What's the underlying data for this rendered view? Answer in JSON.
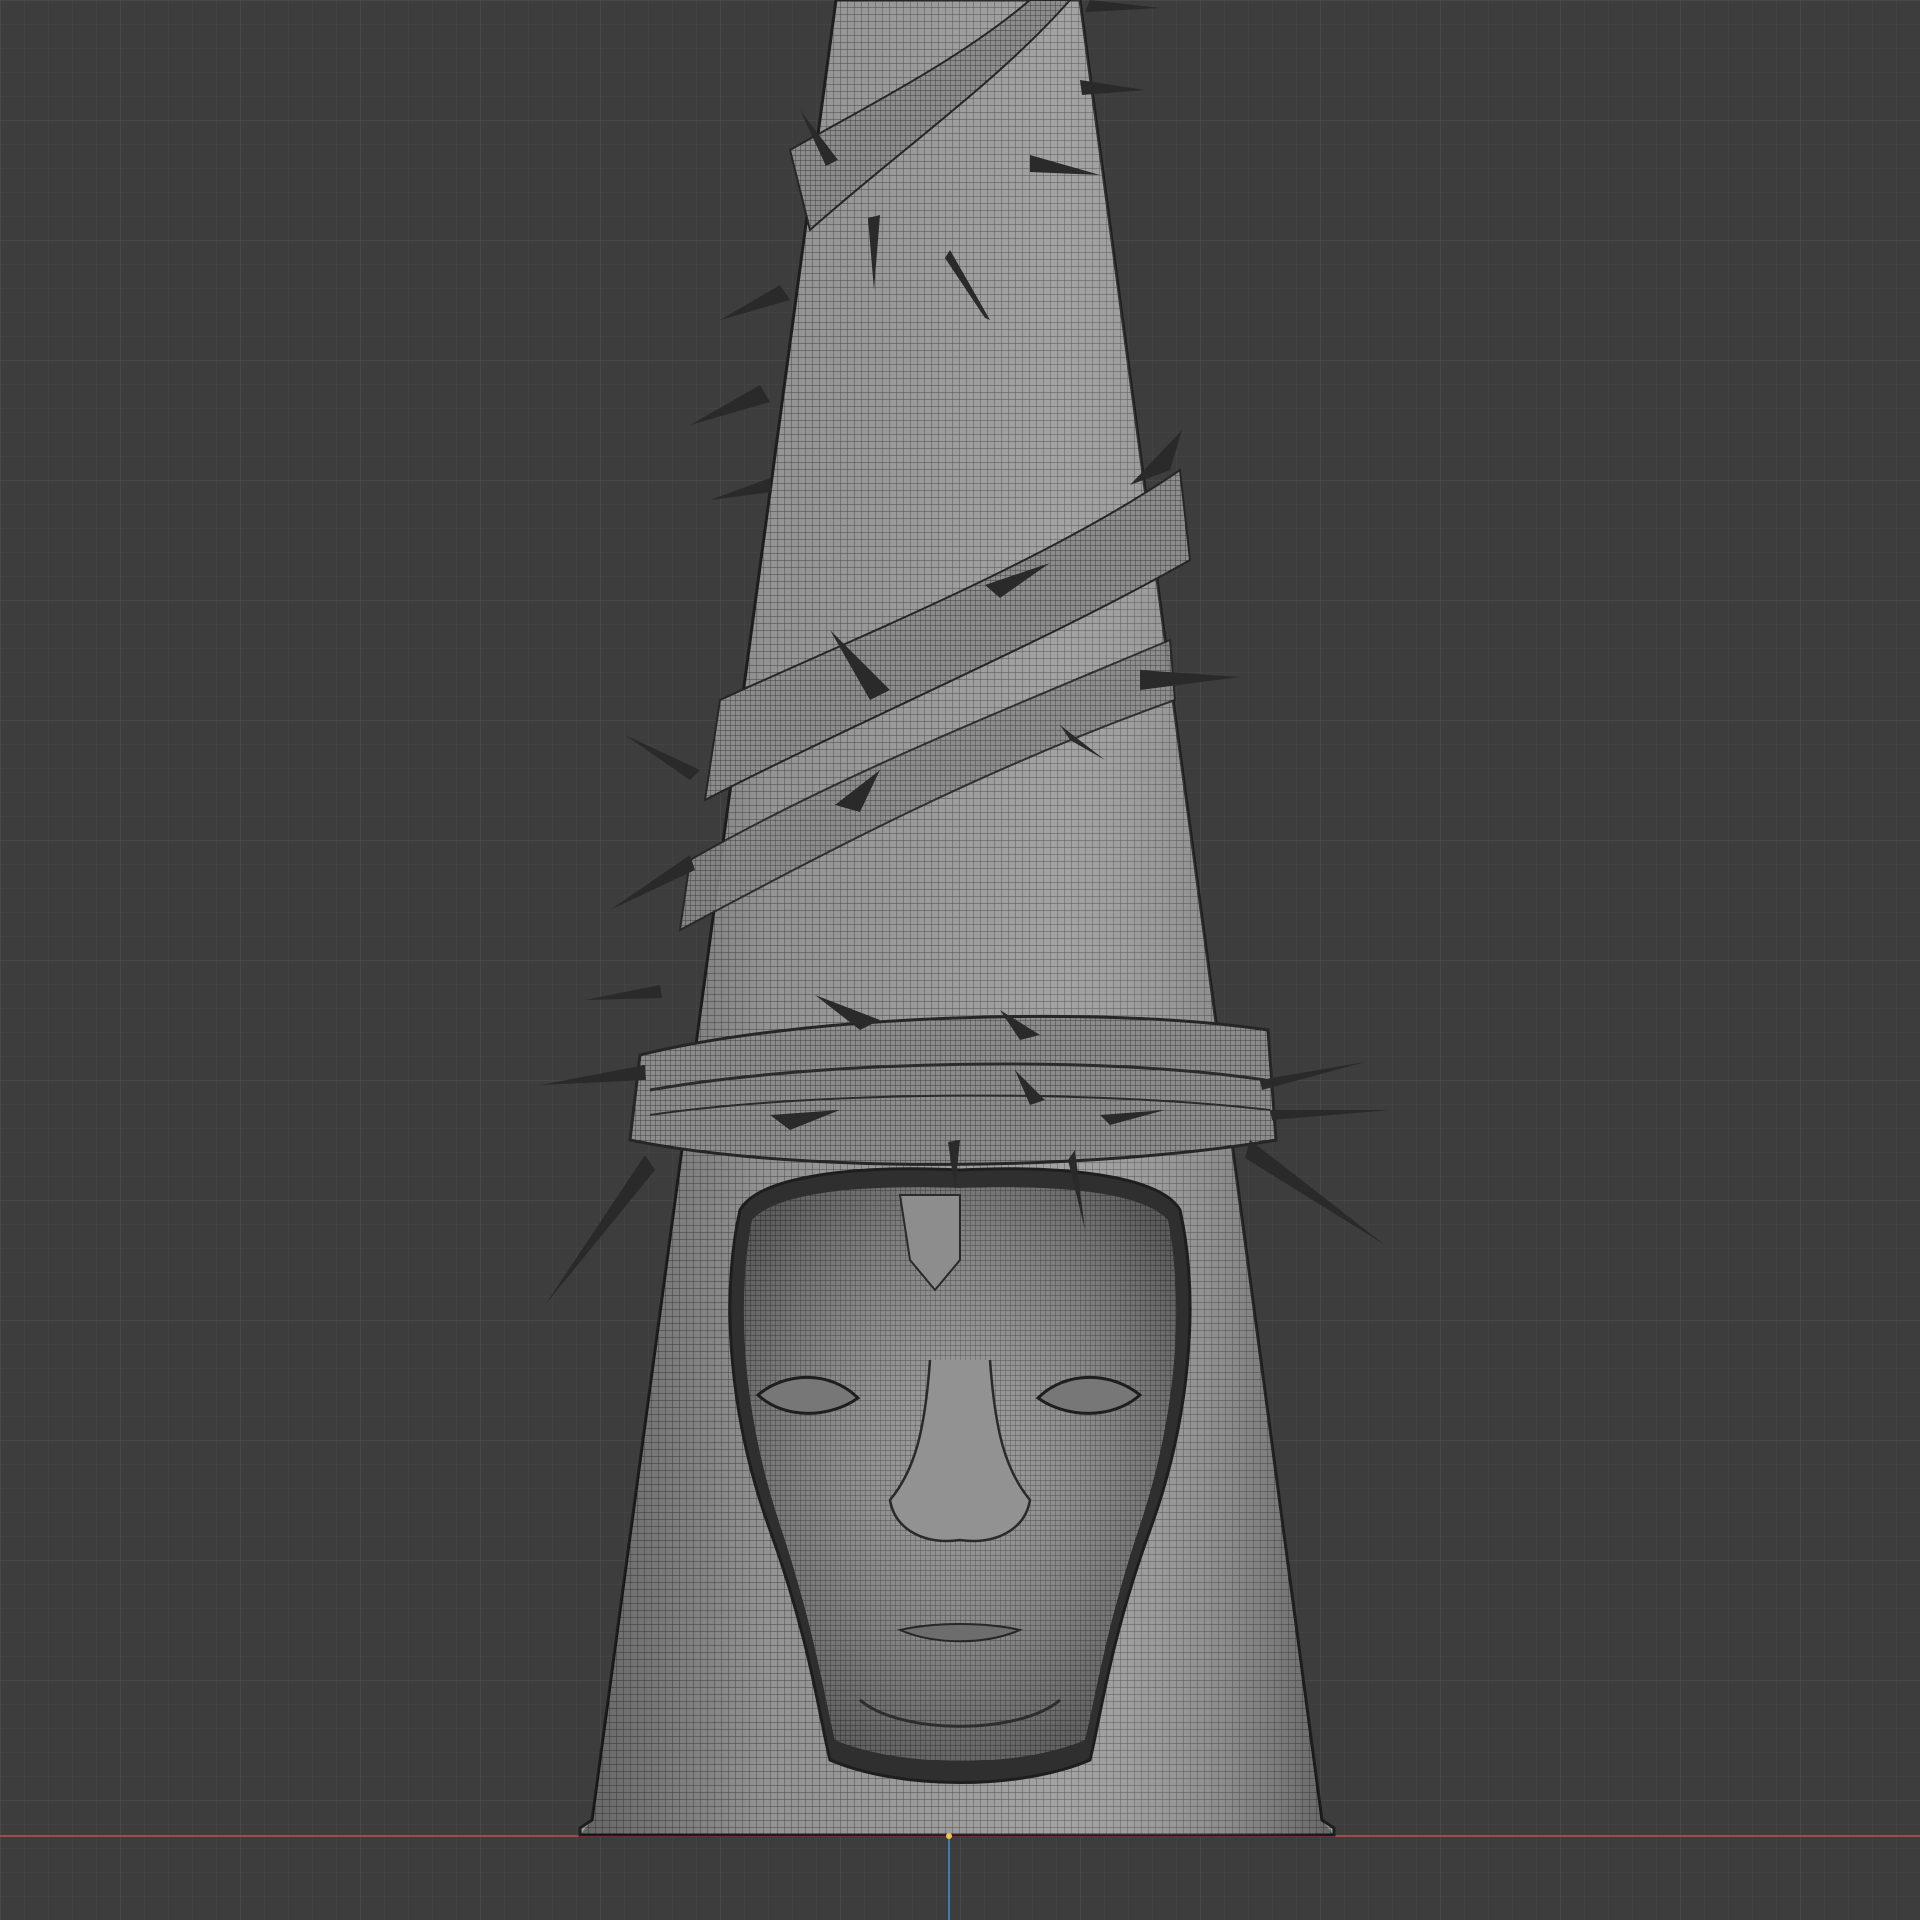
{
  "viewport": {
    "background_color": "#3d3d3d",
    "grid_minor_color": "#464646",
    "grid_major_color": "#4c4c4c",
    "x_axis_color": "#a5484a",
    "y_axis_color": "#3e7bb0",
    "origin_color": "#e6c84a",
    "shading": "wireframe-on-solid",
    "view": "front-orthographic"
  },
  "model": {
    "subject": "hooded-cone-sculpture-with-face",
    "mesh_fill_color": "#9b9b9b",
    "mesh_wire_color": "#3a3a3a",
    "spike_color": "#2a2a2a",
    "features": [
      "cone-hood",
      "wrapped-cloth-bands",
      "thorn-spikes",
      "face"
    ]
  }
}
